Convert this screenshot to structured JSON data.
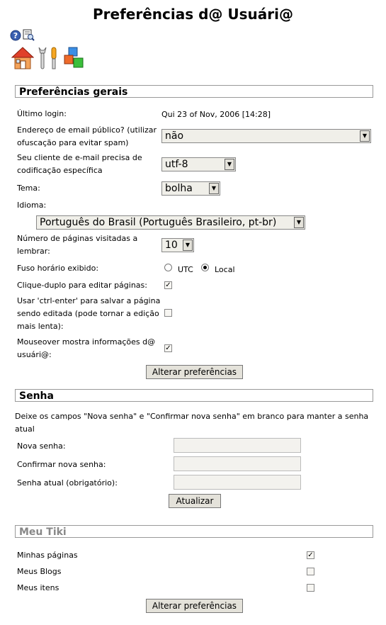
{
  "page": {
    "title": "Preferências d@ Usuári@"
  },
  "toolbar": {
    "icons": [
      "help-icon",
      "print-icon",
      "home-icon",
      "tools-icon",
      "modules-icon"
    ]
  },
  "general": {
    "heading": "Preferências gerais",
    "last_login_label": "Último login:",
    "last_login_value": "Qui 23 of Nov, 2006 [14:28]",
    "public_email_label": "Endereço de email público? (utilizar ofuscação para evitar spam)",
    "public_email_value": "não",
    "encoding_label": "Seu cliente de e-mail precisa de codificação específica",
    "encoding_value": "utf-8",
    "theme_label": "Tema:",
    "theme_value": "bolha",
    "language_label": "Idioma:",
    "language_value": "Português do Brasil (Português Brasileiro, pt-br)",
    "visited_pages_label": "Número de páginas visitadas a lembrar:",
    "visited_pages_value": "10",
    "timezone_label": "Fuso horário exibido:",
    "timezone_utc": "UTC",
    "timezone_local": "Local",
    "doubleclick_label": "Clique-duplo para editar páginas:",
    "ctrl_enter_label": "Usar 'ctrl-enter' para salvar a página sendo editada (pode tornar a edição mais lenta):",
    "mouseover_label": "Mouseover mostra informações d@ usuári@:",
    "submit_label": "Alterar preferências"
  },
  "password": {
    "heading": "Senha",
    "note": "Deixe os campos \"Nova senha\" e \"Confirmar nova senha\" em branco para manter a senha atual",
    "new_label": "Nova senha:",
    "confirm_label": "Confirmar nova senha:",
    "current_label": "Senha atual (obrigatório):",
    "submit_label": "Atualizar"
  },
  "mytiki": {
    "heading": "Meu Tiki",
    "pages_label": "Minhas páginas",
    "blogs_label": "Meus Blogs",
    "items_label": "Meus itens",
    "submit_label": "Alterar preferências"
  }
}
